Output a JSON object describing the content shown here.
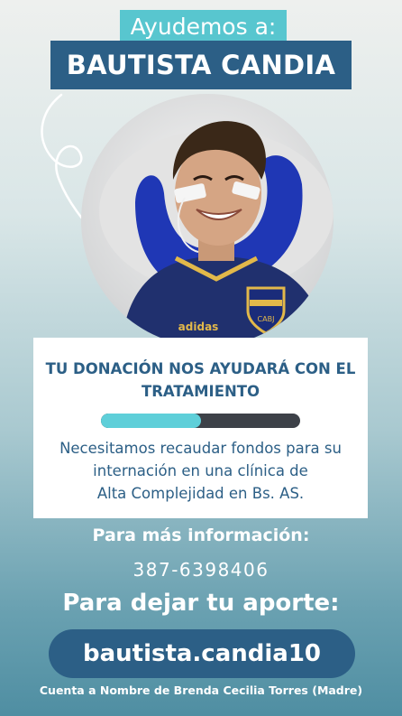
{
  "header": {
    "intro": "Ayudemos a:",
    "name": "BAUTISTA CANDIA"
  },
  "card": {
    "title_line1": "TU DONACIÓN NOS AYUDARÁ CON EL",
    "title_line2": "TRATAMIENTO",
    "progress": 0.5,
    "text_line1": "Necesitamos recaudar fondos para su",
    "text_line2": "internación en una clínica de",
    "text_line3": "Alta Complejidad en Bs. AS."
  },
  "info": {
    "heading": "Para más información:",
    "phone": "387-6398406"
  },
  "donation": {
    "heading": "Para dejar tu aporte:",
    "alias": "bautista.candia10",
    "account_note": "Cuenta a Nombre de Brenda Cecilia Torres (Madre)"
  },
  "photo": {
    "jersey_logo": "CABJ",
    "jersey_brand": "adidas"
  },
  "colors": {
    "accent_teal": "#58c6cf",
    "brand_blue": "#2c5f86",
    "progress_track": "#3d4148"
  }
}
